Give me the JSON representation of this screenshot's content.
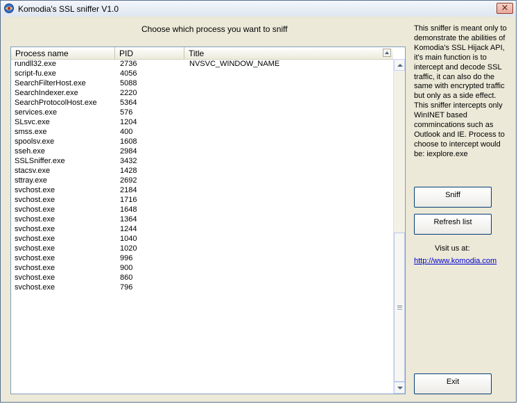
{
  "window": {
    "title": "Komodia's SSL sniffer V1.0",
    "close_glyph": "×",
    "app_icon": "app-icon"
  },
  "main": {
    "prompt": "Choose which process you want to sniff",
    "columns": [
      "Process name",
      "PID",
      "Title"
    ],
    "rows": [
      {
        "name": "rundll32.exe",
        "pid": "2736",
        "title": "NVSVC_WINDOW_NAME"
      },
      {
        "name": "script-fu.exe",
        "pid": "4056",
        "title": ""
      },
      {
        "name": "SearchFilterHost.exe",
        "pid": "5088",
        "title": ""
      },
      {
        "name": "SearchIndexer.exe",
        "pid": "2220",
        "title": ""
      },
      {
        "name": "SearchProtocolHost.exe",
        "pid": "5364",
        "title": ""
      },
      {
        "name": "services.exe",
        "pid": "576",
        "title": ""
      },
      {
        "name": "SLsvc.exe",
        "pid": "1204",
        "title": ""
      },
      {
        "name": "smss.exe",
        "pid": "400",
        "title": ""
      },
      {
        "name": "spoolsv.exe",
        "pid": "1608",
        "title": ""
      },
      {
        "name": "sseh.exe",
        "pid": "2984",
        "title": ""
      },
      {
        "name": "SSLSniffer.exe",
        "pid": "3432",
        "title": ""
      },
      {
        "name": "stacsv.exe",
        "pid": "1428",
        "title": ""
      },
      {
        "name": "sttray.exe",
        "pid": "2692",
        "title": ""
      },
      {
        "name": "svchost.exe",
        "pid": "2184",
        "title": ""
      },
      {
        "name": "svchost.exe",
        "pid": "1716",
        "title": ""
      },
      {
        "name": "svchost.exe",
        "pid": "1648",
        "title": ""
      },
      {
        "name": "svchost.exe",
        "pid": "1364",
        "title": ""
      },
      {
        "name": "svchost.exe",
        "pid": "1244",
        "title": ""
      },
      {
        "name": "svchost.exe",
        "pid": "1040",
        "title": ""
      },
      {
        "name": "svchost.exe",
        "pid": "1020",
        "title": ""
      },
      {
        "name": "svchost.exe",
        "pid": "996",
        "title": ""
      },
      {
        "name": "svchost.exe",
        "pid": "900",
        "title": ""
      },
      {
        "name": "svchost.exe",
        "pid": "860",
        "title": ""
      },
      {
        "name": "svchost.exe",
        "pid": "796",
        "title": ""
      }
    ]
  },
  "side": {
    "description": "This sniffer is meant only to demonstrate the abilities of Komodia's SSL Hijack API, it's main function is to intercept and decode SSL traffic, it can also do the same with encrypted traffic but only as a side effect. This sniffer intercepts only WinINET based commincations such as Outlook and IE. Process to choose to intercept would be: iexplore.exe",
    "sniff_label": "Sniff",
    "refresh_label": "Refresh list",
    "visit_label": "Visit us at:",
    "link_text": "http://www.komodia.com",
    "exit_label": "Exit"
  }
}
